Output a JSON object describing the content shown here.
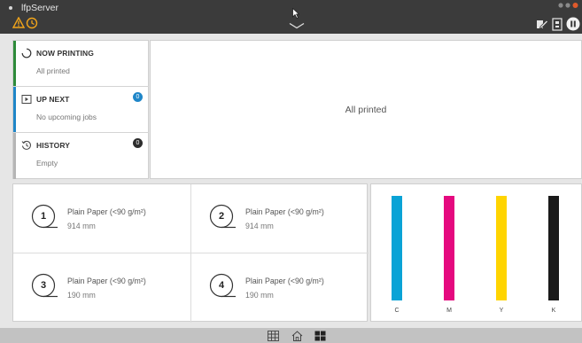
{
  "window": {
    "title": "lfpServer"
  },
  "queue": {
    "now_printing": {
      "label": "NOW PRINTING",
      "status": "All printed",
      "color": "#2e8b3a"
    },
    "up_next": {
      "label": "UP NEXT",
      "status": "No upcoming jobs",
      "count": "0",
      "color": "#1f86c8"
    },
    "history": {
      "label": "HISTORY",
      "status": "Empty",
      "count": "0",
      "color": "#2d2d2d"
    }
  },
  "preview": {
    "message": "All printed"
  },
  "media": {
    "slots": [
      {
        "number": "1",
        "name": "Plain Paper (<90 g/m²)",
        "size": "914 mm"
      },
      {
        "number": "2",
        "name": "Plain Paper (<90 g/m²)",
        "size": "914 mm"
      },
      {
        "number": "3",
        "name": "Plain Paper (<90 g/m²)",
        "size": "190 mm"
      },
      {
        "number": "4",
        "name": "Plain Paper (<90 g/m²)",
        "size": "190 mm"
      }
    ]
  },
  "ink": {
    "cartridges": [
      {
        "label": "C",
        "color": "#0aa3d6",
        "level": 1.0
      },
      {
        "label": "M",
        "color": "#e5097f",
        "level": 1.0
      },
      {
        "label": "Y",
        "color": "#ffd400",
        "level": 1.0
      },
      {
        "label": "K",
        "color": "#1a1a1a",
        "level": 1.0
      }
    ]
  },
  "icons": {
    "menu": "menu-icon",
    "warning": "warning-icon",
    "clock": "clock-icon",
    "chevron": "chevron-down-icon",
    "edit": "edit-icon",
    "bin": "output-bin-icon",
    "pause": "pause-icon",
    "grid": "grid-icon",
    "home": "home-icon",
    "dashboard": "dashboard-icon"
  }
}
